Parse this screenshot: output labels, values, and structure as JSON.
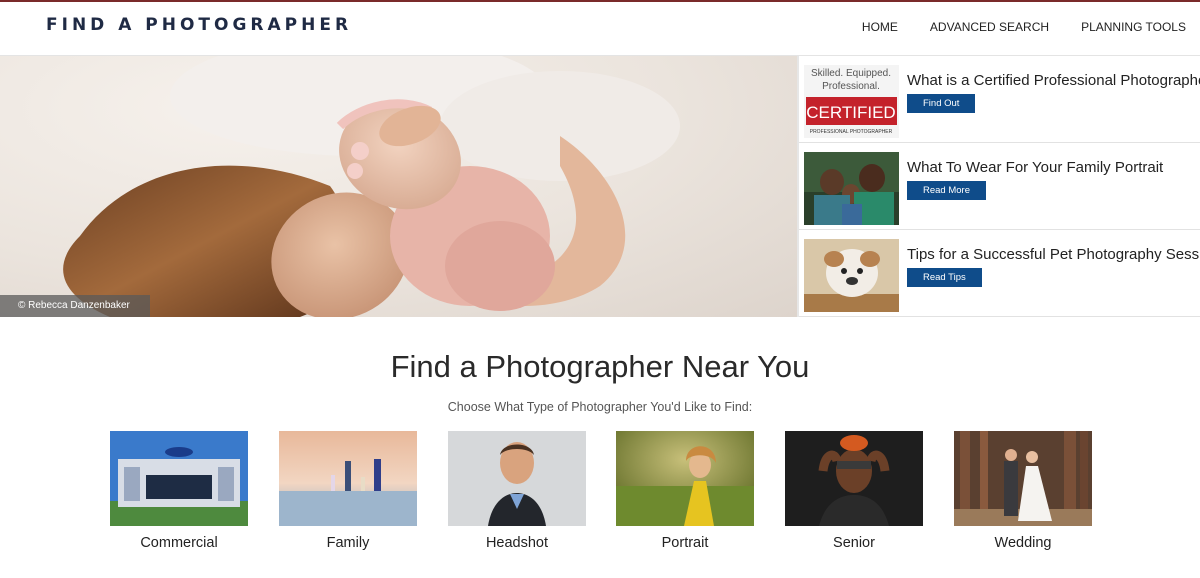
{
  "header": {
    "logo": "FIND A PHOTOGRAPHER",
    "nav": [
      "HOME",
      "ADVANCED SEARCH",
      "PLANNING TOOLS"
    ]
  },
  "hero": {
    "credit": "© Rebecca Danzenbaker"
  },
  "features": [
    {
      "title": "What is a Certified Professional Photographer?",
      "button": "Find Out",
      "thumb_text": [
        "Skilled. Equipped.",
        "Professional.",
        "CERTIFIED",
        "PROFESSIONAL PHOTOGRAPHER"
      ]
    },
    {
      "title": "What To Wear For Your Family Portrait",
      "button": "Read More"
    },
    {
      "title": "Tips for a Successful Pet Photography Session",
      "button": "Read Tips"
    }
  ],
  "main": {
    "title": "Find a Photographer Near You",
    "subtitle": "Choose What Type of Photographer You'd Like to Find:",
    "categories": [
      "Commercial",
      "Family",
      "Headshot",
      "Portrait",
      "Senior",
      "Wedding"
    ]
  },
  "colors": {
    "button_blue": "#0f4c8a",
    "logo_navy": "#1f2a44",
    "certified_red": "#c4222b"
  }
}
